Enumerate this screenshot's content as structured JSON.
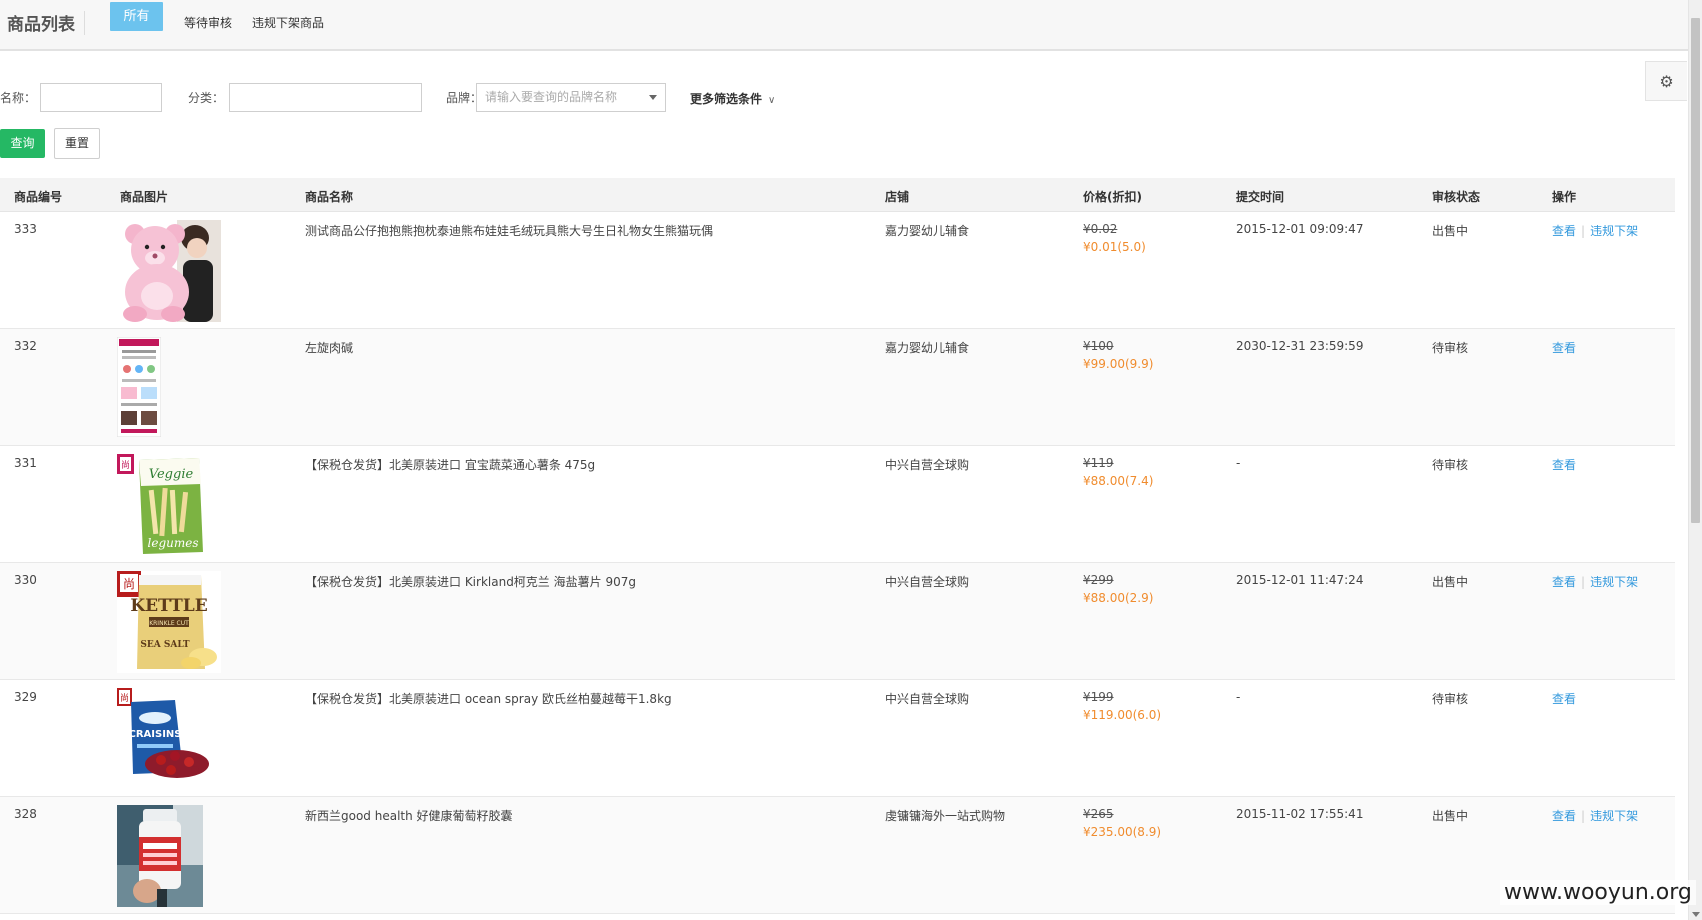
{
  "header": {
    "title": "商品列表",
    "tabs": [
      {
        "label": "所有",
        "active": true
      },
      {
        "label": "等待审核",
        "active": false
      },
      {
        "label": "违规下架商品",
        "active": false
      }
    ]
  },
  "filters": {
    "name_label": "名称：",
    "name_value": "",
    "category_label": "分类：",
    "category_value": "",
    "brand_label": "品牌：",
    "brand_placeholder": "请输入要查询的品牌名称",
    "more_label": "更多筛选条件",
    "query_button": "查询",
    "reset_button": "重置"
  },
  "table": {
    "columns": [
      "商品编号",
      "商品图片",
      "商品名称",
      "店铺",
      "价格(折扣)",
      "提交时间",
      "审核状态",
      "操作"
    ],
    "rows": [
      {
        "id": "333",
        "name": "测试商品公仔抱抱熊抱枕泰迪熊布娃娃毛绒玩具熊大号生日礼物女生熊猫玩偶",
        "shop": "嘉力婴幼儿辅食",
        "price_old": "¥0.02",
        "price_new": "¥0.01(5.0)",
        "time": "2015-12-01 09:09:47",
        "status": "出售中",
        "view": "查看",
        "takedown": "违规下架",
        "image_icon": "pink-teddy-bear-image"
      },
      {
        "id": "332",
        "name": "左旋肉碱",
        "shop": "嘉力婴幼儿辅食",
        "price_old": "¥100",
        "price_new": "¥99.00(9.9)",
        "time": "2030-12-31 23:59:59",
        "status": "待审核",
        "view": "查看",
        "takedown": "",
        "image_icon": "product-poster-image"
      },
      {
        "id": "331",
        "name": "【保税仓发货】北美原装进口 宜宝蔬菜通心薯条 475g",
        "shop": "中兴自营全球购",
        "price_old": "¥119",
        "price_new": "¥88.00(7.4)",
        "time": "-",
        "status": "待审核",
        "view": "查看",
        "takedown": "",
        "image_icon": "veggie-fries-bag-image"
      },
      {
        "id": "330",
        "name": "【保税仓发货】北美原装进口 Kirkland柯克兰 海盐薯片 907g",
        "shop": "中兴自营全球购",
        "price_old": "¥299",
        "price_new": "¥88.00(2.9)",
        "time": "2015-12-01 11:47:24",
        "status": "出售中",
        "view": "查看",
        "takedown": "违规下架",
        "image_icon": "chips-bag-image"
      },
      {
        "id": "329",
        "name": "【保税仓发货】北美原装进口 ocean spray 欧氏丝柏蔓越莓干1.8kg",
        "shop": "中兴自营全球购",
        "price_old": "¥199",
        "price_new": "¥119.00(6.0)",
        "time": "-",
        "status": "待审核",
        "view": "查看",
        "takedown": "",
        "image_icon": "craisins-bag-image"
      },
      {
        "id": "328",
        "name": "新西兰good health 好健康葡萄籽胶囊",
        "shop": "虔镛镛海外一站式购物",
        "price_old": "¥265",
        "price_new": "¥235.00(8.9)",
        "time": "2015-11-02 17:55:41",
        "status": "出售中",
        "view": "查看",
        "takedown": "违规下架",
        "image_icon": "supplement-bottle-image"
      }
    ]
  },
  "watermark": "www.wooyun.org",
  "colors": {
    "accent_tab": "#6cc3ee",
    "query_green": "#25b864",
    "price_orange": "#f08c2e",
    "link_blue": "#3399dd"
  }
}
